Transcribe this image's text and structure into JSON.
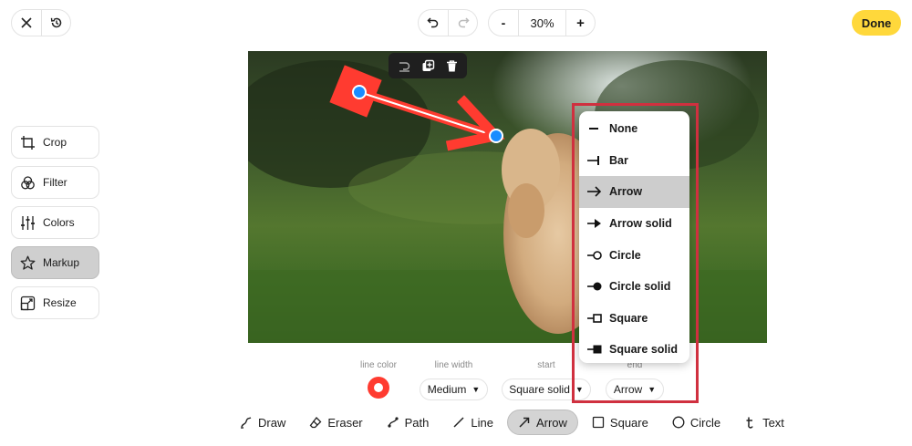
{
  "header": {
    "close_icon": "close-icon",
    "history_icon": "history-icon",
    "undo_icon": "undo-icon",
    "redo_icon": "redo-icon",
    "zoom_out_label": "-",
    "zoom_value": "30%",
    "zoom_in_label": "+",
    "done_label": "Done"
  },
  "sidebar": {
    "items": [
      {
        "label": "Crop",
        "icon": "crop-icon"
      },
      {
        "label": "Filter",
        "icon": "filter-icon"
      },
      {
        "label": "Colors",
        "icon": "sliders-icon"
      },
      {
        "label": "Markup",
        "icon": "star-icon",
        "active": true
      },
      {
        "label": "Resize",
        "icon": "resize-icon"
      }
    ]
  },
  "shape_toolbar": {
    "icons": [
      "move-to-back-icon",
      "duplicate-icon",
      "trash-icon"
    ]
  },
  "properties": {
    "line_color": {
      "label": "line color",
      "value": "#ff3b30"
    },
    "line_width": {
      "label": "line width",
      "value": "Medium"
    },
    "start": {
      "label": "start",
      "value": "Square solid"
    },
    "end": {
      "label": "end",
      "value": "Arrow"
    }
  },
  "end_dropdown": {
    "selected": "Arrow",
    "options": [
      "None",
      "Bar",
      "Arrow",
      "Arrow solid",
      "Circle",
      "Circle solid",
      "Square",
      "Square solid"
    ]
  },
  "tools": [
    {
      "label": "Draw",
      "icon": "draw-icon"
    },
    {
      "label": "Eraser",
      "icon": "eraser-icon"
    },
    {
      "label": "Path",
      "icon": "path-icon"
    },
    {
      "label": "Line",
      "icon": "line-icon"
    },
    {
      "label": "Arrow",
      "icon": "arrow-icon",
      "active": true
    },
    {
      "label": "Square",
      "icon": "square-icon"
    },
    {
      "label": "Circle",
      "icon": "circle-icon"
    },
    {
      "label": "Text",
      "icon": "text-icon"
    }
  ],
  "colors": {
    "accent_done": "#ffd83b",
    "markup_red": "#ff3b30",
    "handle_blue": "#1a8cff",
    "highlight_border": "#d0303f"
  }
}
